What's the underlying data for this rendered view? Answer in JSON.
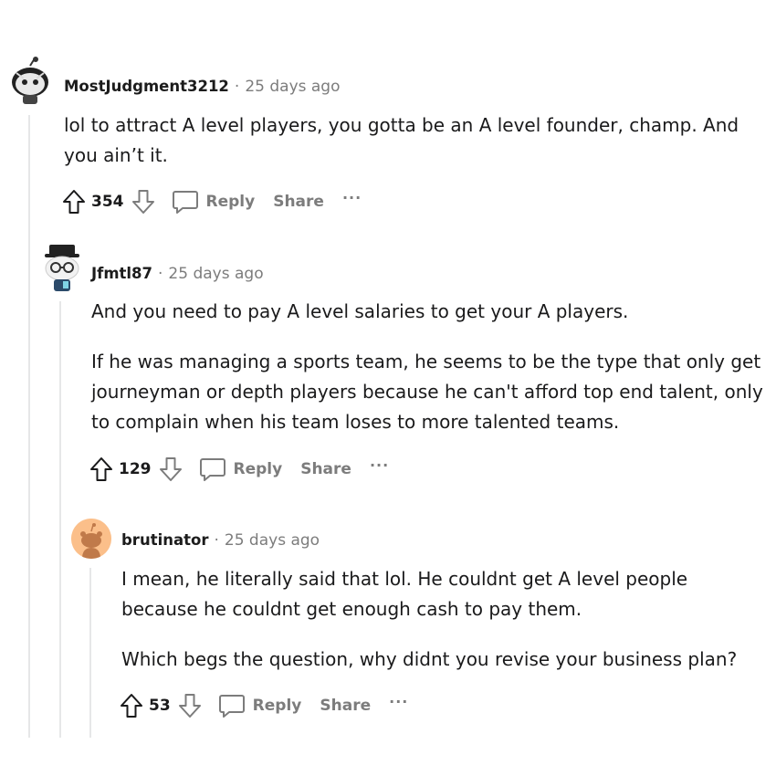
{
  "comments": [
    {
      "username": "MostJudgment3212",
      "separator": "·",
      "time": "25 days ago",
      "paragraphs": [
        "lol to attract A level players, you gotta be an A level founder, champ. And you ain’t it."
      ],
      "votes": "354",
      "reply_label": "Reply",
      "share_label": "Share",
      "more_label": "···",
      "avatar_icon": "snoo-avatar-icon"
    },
    {
      "username": "Jfmtl87",
      "separator": "·",
      "time": "25 days ago",
      "paragraphs": [
        "And you need to pay A level salaries to get your A players.",
        "If he was managing a sports team, he seems to be the type that only get journeyman or depth players because he can't afford top end talent, only to complain when his team loses to more talented teams."
      ],
      "votes": "129",
      "reply_label": "Reply",
      "share_label": "Share",
      "more_label": "···",
      "avatar_icon": "snoo-avatar-icon"
    },
    {
      "username": "brutinator",
      "separator": "·",
      "time": "25 days ago",
      "paragraphs": [
        "I mean, he literally said that lol. He couldnt get A level people because he couldnt get enough cash to pay them.",
        "Which begs the question, why didnt you revise your business plan?"
      ],
      "votes": "53",
      "reply_label": "Reply",
      "share_label": "Share",
      "more_label": "···",
      "avatar_icon": "default-snoo-avatar-icon"
    }
  ],
  "colors": {
    "text": "#1a1a1b",
    "muted": "#7c7c7c",
    "thread_line": "#e6e7e8",
    "default_avatar_bg": "#fbbf8a"
  }
}
